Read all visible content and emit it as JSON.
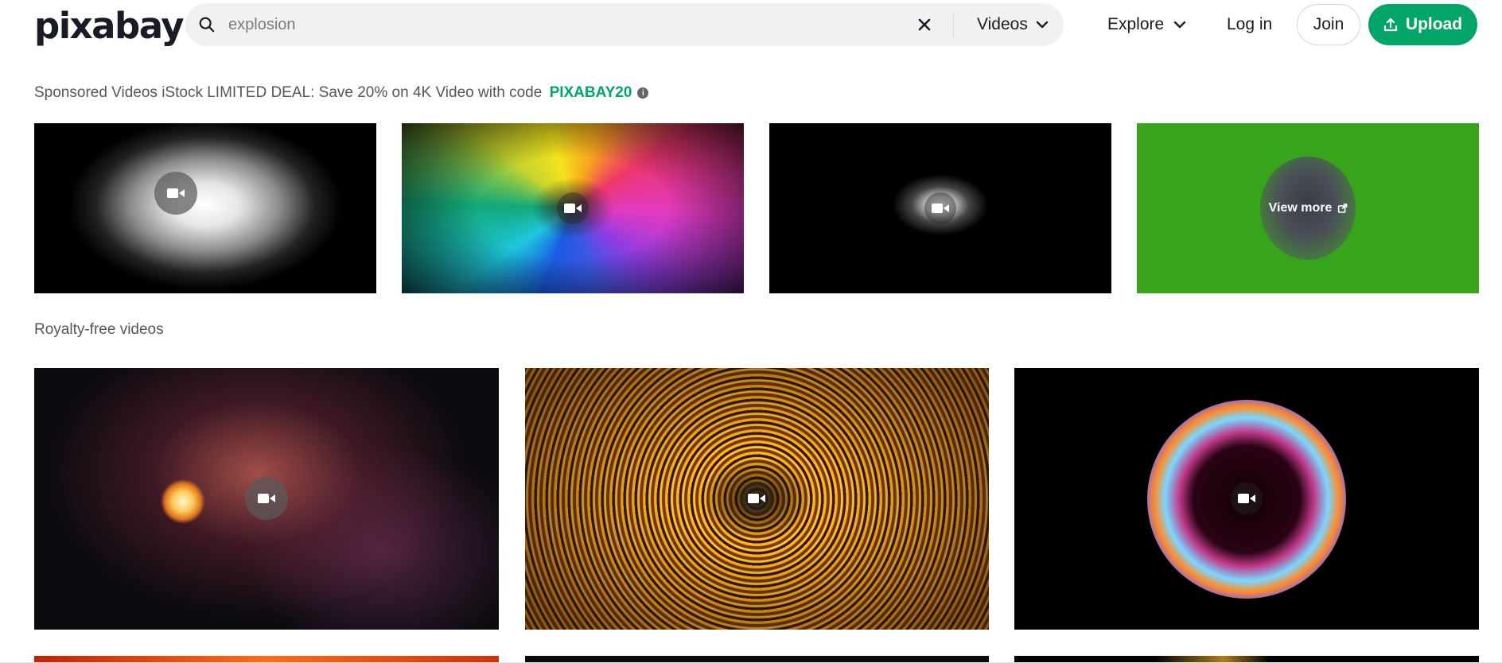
{
  "header": {
    "logo_text": "pixabay",
    "search": {
      "value": "explosion",
      "placeholder": "explosion"
    },
    "media_type": "Videos",
    "nav": {
      "explore": "Explore",
      "login": "Log in",
      "join": "Join",
      "upload": "Upload"
    }
  },
  "sponsored": {
    "text": "Sponsored Videos iStock LIMITED DEAL: Save 20% on 4K Video with code ",
    "code": "PIXABAY20",
    "view_more": "View more"
  },
  "royalty_free": {
    "title": "Royalty-free videos"
  },
  "colors": {
    "accent": "#02a567",
    "sponsored_tile_green": "#37a41b"
  },
  "icons": [
    "search-icon",
    "clear-icon",
    "chevron-down-icon",
    "upload-icon",
    "info-icon",
    "video-camera-icon",
    "external-link-icon"
  ]
}
